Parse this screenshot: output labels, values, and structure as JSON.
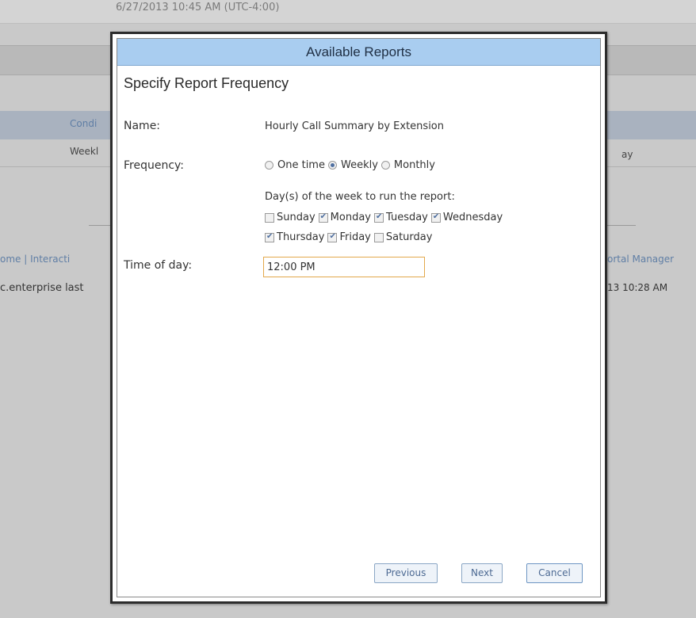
{
  "background": {
    "timestamp": "6/27/2013 10:45 AM (UTC-4:00)",
    "cond_fragment": "Condi",
    "weekl_fragment": "Weekl",
    "y_fragment": "ay",
    "links_left": "ome | Interacti",
    "links_right": "ortal Manager",
    "status_left": "c.enterprise last",
    "status_right": "13 10:28 AM"
  },
  "dialog": {
    "title": "Available Reports",
    "subtitle": "Specify Report Frequency",
    "name_label": "Name:",
    "name_value": "Hourly Call Summary by Extension",
    "frequency_label": "Frequency:",
    "frequency_options": [
      {
        "label": "One time",
        "checked": false
      },
      {
        "label": "Weekly",
        "checked": true
      },
      {
        "label": "Monthly",
        "checked": false
      }
    ],
    "days_caption": "Day(s) of the week to run the report:",
    "days": [
      {
        "label": "Sunday",
        "checked": false
      },
      {
        "label": "Monday",
        "checked": true
      },
      {
        "label": "Tuesday",
        "checked": true
      },
      {
        "label": "Wednesday",
        "checked": true
      },
      {
        "label": "Thursday",
        "checked": true
      },
      {
        "label": "Friday",
        "checked": true
      },
      {
        "label": "Saturday",
        "checked": false
      }
    ],
    "time_label": "Time of day:",
    "time_value": "12:00 PM",
    "buttons": {
      "previous": "Previous",
      "next": "Next",
      "cancel": "Cancel"
    }
  },
  "colors": {
    "titlebar": "#a9cdf0",
    "input_focus_border": "#e3a84c",
    "radio_check": "#4e6fa0"
  }
}
